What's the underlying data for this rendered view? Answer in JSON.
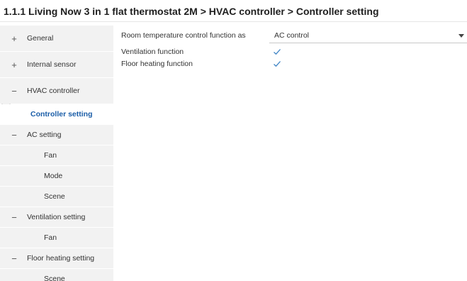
{
  "header": {
    "title": "1.1.1 Living Now 3 in 1 flat thermostat 2M > HVAC controller > Controller setting"
  },
  "sidebar": {
    "items": [
      {
        "label": "General",
        "sign": "+"
      },
      {
        "label": "Internal sensor",
        "sign": "+"
      },
      {
        "label": "HVAC controller",
        "sign": "−"
      },
      {
        "label": "Controller setting"
      },
      {
        "label": "AC setting",
        "sign": "−"
      },
      {
        "label": "Fan"
      },
      {
        "label": "Mode"
      },
      {
        "label": "Scene"
      },
      {
        "label": "Ventilation setting",
        "sign": "−"
      },
      {
        "label": "Fan"
      },
      {
        "label": "Floor heating setting",
        "sign": "−"
      },
      {
        "label": "Scene"
      }
    ]
  },
  "settings": {
    "room_temp_label": "Room temperature control function as",
    "room_temp_value": "AC control",
    "ventilation_label": "Ventilation function",
    "ventilation_checked": true,
    "floor_heating_label": "Floor heating function",
    "floor_heating_checked": true
  },
  "colors": {
    "accent": "#1b5ea8",
    "check": "#3b82c4",
    "sidebar_bg": "#f2f2f2"
  },
  "icons": {
    "expand": "plus-icon",
    "collapse": "minus-icon",
    "dropdown": "chevron-down-icon",
    "checkbox": "checkmark-icon"
  }
}
